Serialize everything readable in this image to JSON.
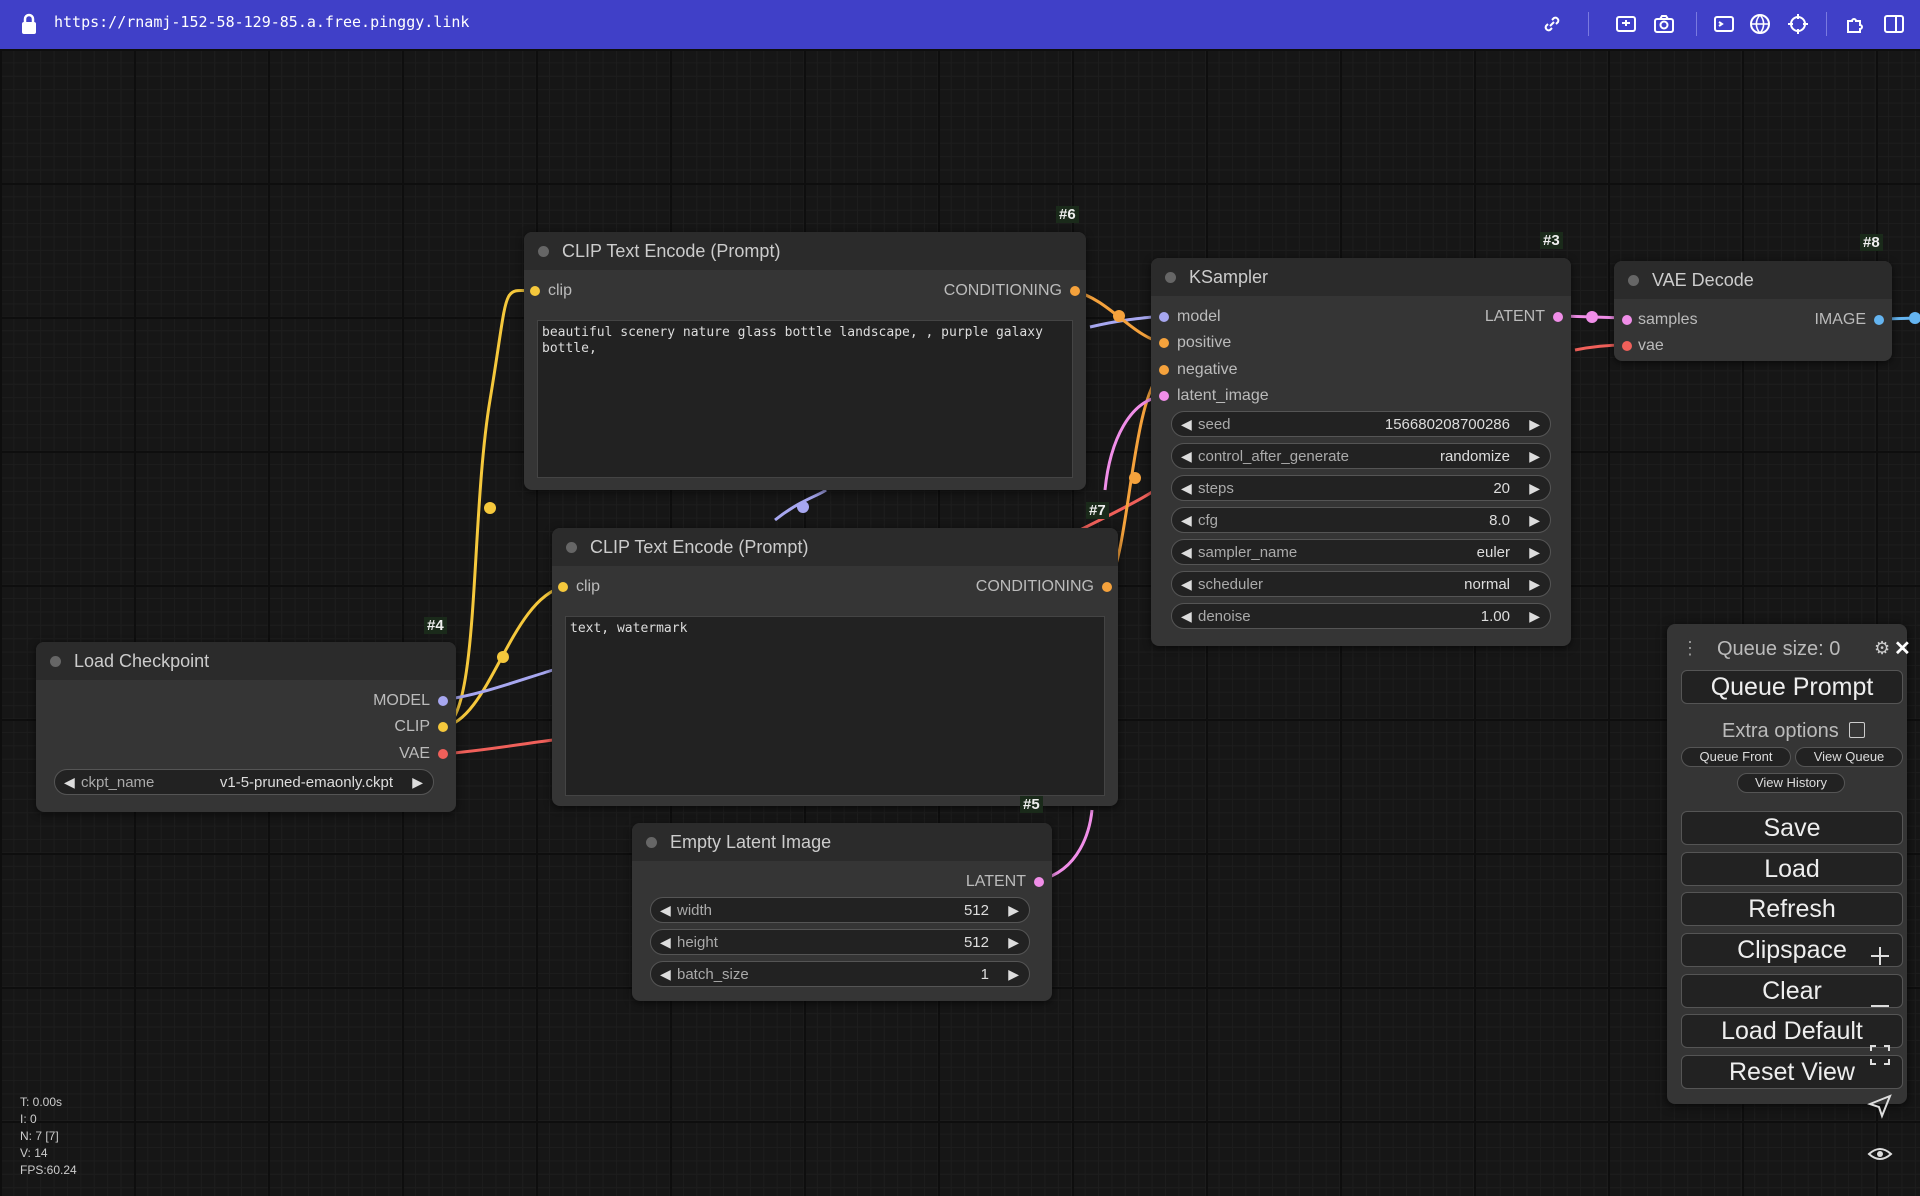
{
  "browser": {
    "url": "https://rnamj-152-58-129-85.a.free.pinggy.link",
    "icons": [
      "lock-icon",
      "link-icon",
      "screenshot-icon",
      "camera-icon",
      "terminal-icon",
      "globe-icon",
      "crosshair-icon",
      "extension-icon",
      "sidebar-icon"
    ]
  },
  "nodes": {
    "clip_pos": {
      "id": "#6",
      "title": "CLIP Text Encode (Prompt)",
      "input": "clip",
      "output": "CONDITIONING",
      "text": "beautiful scenery nature glass bottle landscape, , purple galaxy\nbottle,"
    },
    "clip_neg": {
      "id": "#7",
      "title": "CLIP Text Encode (Prompt)",
      "input": "clip",
      "output": "CONDITIONING",
      "text": "text, watermark"
    },
    "ksampler": {
      "id": "#3",
      "title": "KSampler",
      "inputs": [
        "model",
        "positive",
        "negative",
        "latent_image"
      ],
      "output": "LATENT",
      "widgets": [
        {
          "label": "seed",
          "value": "156680208700286"
        },
        {
          "label": "control_after_generate",
          "value": "randomize"
        },
        {
          "label": "steps",
          "value": "20"
        },
        {
          "label": "cfg",
          "value": "8.0"
        },
        {
          "label": "sampler_name",
          "value": "euler"
        },
        {
          "label": "scheduler",
          "value": "normal"
        },
        {
          "label": "denoise",
          "value": "1.00"
        }
      ]
    },
    "vae_decode": {
      "id": "#8",
      "title": "VAE Decode",
      "inputs": [
        "samples",
        "vae"
      ],
      "output": "IMAGE"
    },
    "load_checkpoint": {
      "id": "#4",
      "title": "Load Checkpoint",
      "outputs": [
        "MODEL",
        "CLIP",
        "VAE"
      ],
      "widget": {
        "label": "ckpt_name",
        "value": "v1-5-pruned-emaonly.ckpt"
      }
    },
    "empty_latent": {
      "id": "#5",
      "title": "Empty Latent Image",
      "output": "LATENT",
      "widgets": [
        {
          "label": "width",
          "value": "512"
        },
        {
          "label": "height",
          "value": "512"
        },
        {
          "label": "batch_size",
          "value": "1"
        }
      ]
    }
  },
  "menu": {
    "queue_size": "Queue size: 0",
    "queue_prompt": "Queue Prompt",
    "extra_options": "Extra options",
    "queue_front": "Queue Front",
    "view_queue": "View Queue",
    "view_history": "View History",
    "save": "Save",
    "load": "Load",
    "refresh": "Refresh",
    "clipspace": "Clipspace",
    "clear": "Clear",
    "load_default": "Load Default",
    "reset_view": "Reset View"
  },
  "colors": {
    "clip": "#f5c83c",
    "conditioning": "#f5a23c",
    "model": "#a7a7f0",
    "latent": "#f08ee8",
    "vae": "#f0605a",
    "image": "#64b4f0"
  },
  "stats": {
    "t": "T: 0.00s",
    "i": "I: 0",
    "n": "N: 7 [7]",
    "v": "V: 14",
    "fps": "FPS:60.24"
  }
}
